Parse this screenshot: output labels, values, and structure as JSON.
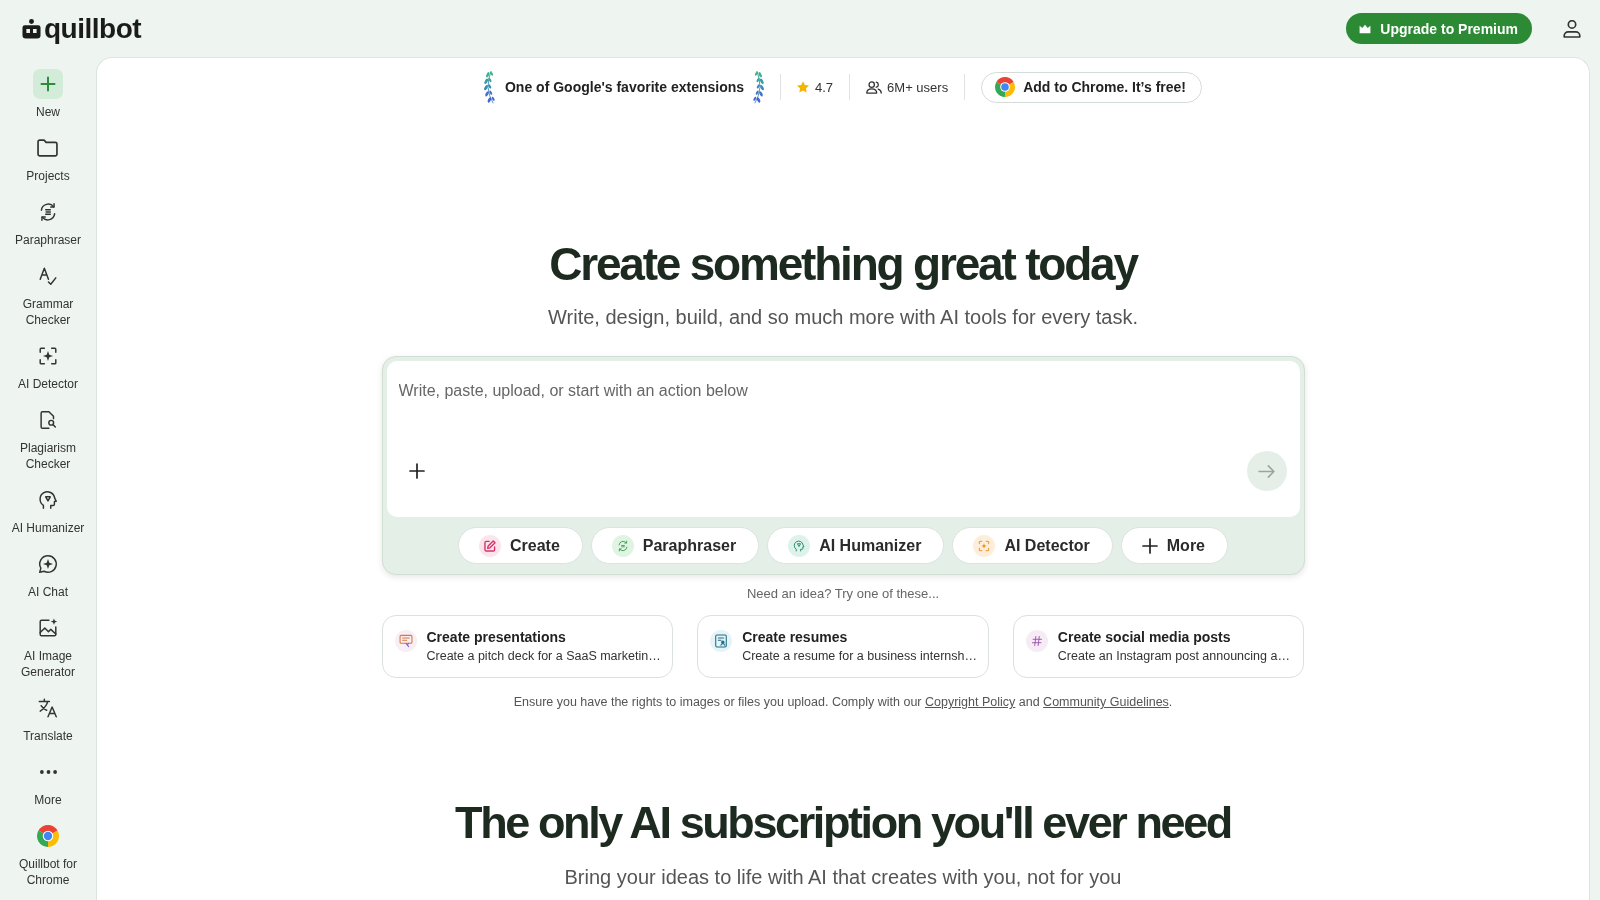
{
  "header": {
    "logo": "quillbot",
    "upgrade_button": "Upgrade to Premium"
  },
  "sidebar": {
    "new_label": "New",
    "items": [
      {
        "label": "Projects"
      },
      {
        "label": "Paraphraser"
      },
      {
        "label": "Grammar Checker"
      },
      {
        "label": "AI Detector"
      },
      {
        "label": "Plagiarism Checker"
      },
      {
        "label": "AI Humanizer"
      },
      {
        "label": "AI Chat"
      },
      {
        "label": "AI Image Generator"
      },
      {
        "label": "Translate"
      },
      {
        "label": "More"
      },
      {
        "label": "Quillbot for Chrome"
      }
    ]
  },
  "badge_bar": {
    "award": "One of Google's favorite extensions",
    "rating": "4.7",
    "users": "6M+ users",
    "chrome_button": "Add to Chrome. It’s free!"
  },
  "hero": {
    "title": "Create something great today",
    "subtitle": "Write, design, build, and so much more with AI tools for every task."
  },
  "composer": {
    "placeholder": "Write, paste, upload, or start with an action below",
    "actions": [
      "Create",
      "Paraphraser",
      "AI Humanizer",
      "AI Detector",
      "More"
    ]
  },
  "ideas": {
    "prompt": "Need an idea? Try one of these...",
    "cards": [
      {
        "title": "Create presentations",
        "description": "Create a pitch deck for a SaaS marketin…"
      },
      {
        "title": "Create resumes",
        "description": "Create a resume for a business internsh…"
      },
      {
        "title": "Create social media posts",
        "description": "Create an Instagram post announcing a…"
      }
    ]
  },
  "notice": {
    "parts": [
      {
        "kind": "text",
        "text": "Ensure you have the rights to images or files you upload. Comply with our "
      },
      {
        "kind": "link",
        "text": "Copyright Policy"
      },
      {
        "kind": "text",
        "text": " and "
      },
      {
        "kind": "link",
        "text": "Community Guidelines"
      },
      {
        "kind": "text",
        "text": "."
      }
    ]
  },
  "section": {
    "title": "The only AI subscription you'll ever need",
    "subtitle": "Bring your ideas to life with AI that creates with you, not for you"
  }
}
